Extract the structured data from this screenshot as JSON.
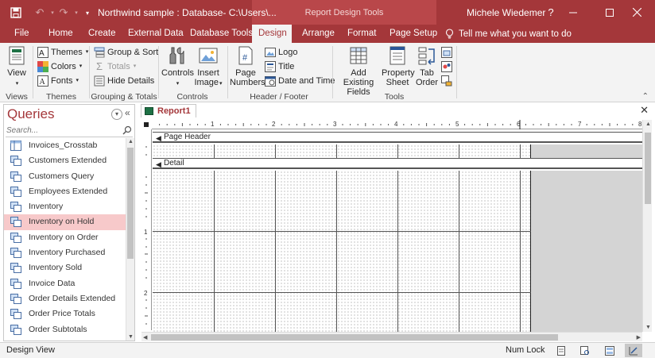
{
  "titlebar": {
    "document_title": "Northwind sample : Database- C:\\Users\\...",
    "context_title": "Report Design Tools",
    "user_name": "Michele Wiedemer",
    "help_label": "?"
  },
  "tabs": [
    {
      "label": "File",
      "active": false
    },
    {
      "label": "Home",
      "active": false
    },
    {
      "label": "Create",
      "active": false
    },
    {
      "label": "External Data",
      "active": false
    },
    {
      "label": "Database Tools",
      "active": false
    },
    {
      "label": "Design",
      "active": true
    },
    {
      "label": "Arrange",
      "active": false
    },
    {
      "label": "Format",
      "active": false
    },
    {
      "label": "Page Setup",
      "active": false
    }
  ],
  "tell_me": "Tell me what you want to do",
  "ribbon": {
    "views": {
      "view_label": "View",
      "group": "Views"
    },
    "themes": {
      "themes_label": "Themes",
      "colors_label": "Colors",
      "fonts_label": "Fonts",
      "group": "Themes"
    },
    "grouping": {
      "group_sort_label": "Group & Sort",
      "totals_label": "Totals",
      "hide_details_label": "Hide Details",
      "group": "Grouping & Totals"
    },
    "controls": {
      "controls_label": "Controls",
      "insert_image_line1": "Insert",
      "insert_image_line2": "Image",
      "group": "Controls"
    },
    "header_footer": {
      "page_numbers_line1": "Page",
      "page_numbers_line2": "Numbers",
      "logo_label": "Logo",
      "title_label": "Title",
      "date_time_label": "Date and Time",
      "group": "Header / Footer"
    },
    "tools": {
      "add_fields_line1": "Add Existing",
      "add_fields_line2": "Fields",
      "property_line1": "Property",
      "property_line2": "Sheet",
      "tab_order_line1": "Tab",
      "tab_order_line2": "Order",
      "group": "Tools"
    }
  },
  "nav": {
    "title": "Queries",
    "search_placeholder": "Search...",
    "items": [
      {
        "label": "Invoices_Crosstab",
        "selected": false
      },
      {
        "label": "Customers Extended",
        "selected": false
      },
      {
        "label": "Customers Query",
        "selected": false
      },
      {
        "label": "Employees Extended",
        "selected": false
      },
      {
        "label": "Inventory",
        "selected": false
      },
      {
        "label": "Inventory on Hold",
        "selected": true
      },
      {
        "label": "Inventory on Order",
        "selected": false
      },
      {
        "label": "Inventory Purchased",
        "selected": false
      },
      {
        "label": "Inventory Sold",
        "selected": false
      },
      {
        "label": "Invoice Data",
        "selected": false
      },
      {
        "label": "Order Details Extended",
        "selected": false
      },
      {
        "label": "Order Price Totals",
        "selected": false
      },
      {
        "label": "Order Subtotals",
        "selected": false
      }
    ]
  },
  "document": {
    "tab_label": "Report1",
    "sections": {
      "page_header": "Page Header",
      "detail": "Detail"
    },
    "ruler_h": [
      "1",
      "2",
      "3",
      "4",
      "5",
      "6",
      "7",
      "8"
    ],
    "ruler_v": [
      "1",
      "2"
    ]
  },
  "status": {
    "left": "Design View",
    "num_lock": "Num Lock"
  },
  "colors": {
    "accent": "#a4373a",
    "context_tab": "#b9474a",
    "selection": "#f7c9ca"
  }
}
